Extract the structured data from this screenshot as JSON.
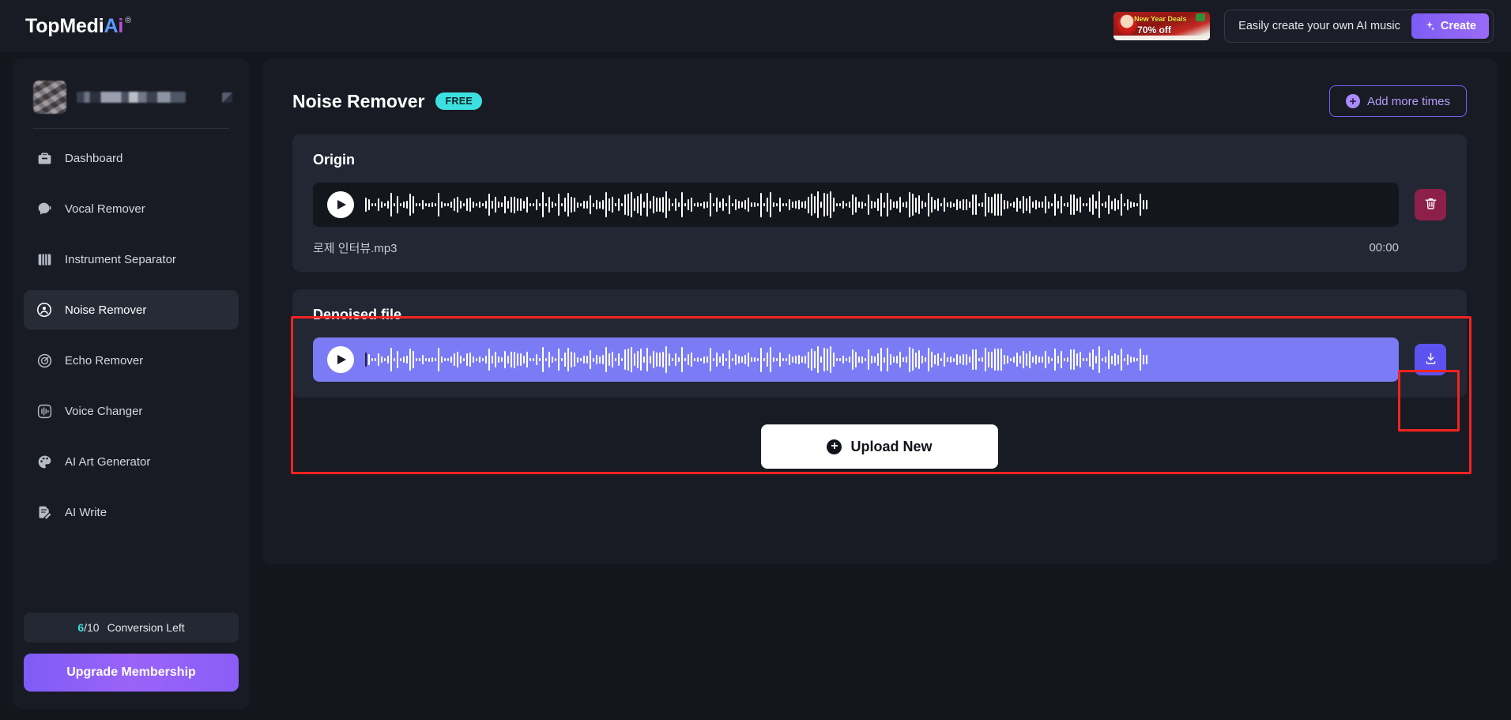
{
  "topbar": {
    "logo": {
      "prefix": "TopMedi",
      "mark_a": "A",
      "mark_i": "i",
      "registered": "®"
    },
    "promo": {
      "line1": "New Year Deals",
      "line2": "70% off"
    },
    "music_text": "Easily create your own AI music",
    "create_label": "Create",
    "spark_icon": "sparkle-icon"
  },
  "sidebar": {
    "profile": {
      "avatar_icon": "user-avatar",
      "name_redacted": "",
      "more_icon": "more-icon"
    },
    "items": [
      {
        "label": "Dashboard",
        "icon": "briefcase-icon",
        "active": false
      },
      {
        "label": "Vocal Remover",
        "icon": "vocal-icon",
        "active": false
      },
      {
        "label": "Instrument Separator",
        "icon": "piano-icon",
        "active": false
      },
      {
        "label": "Noise Remover",
        "icon": "noise-icon",
        "active": true
      },
      {
        "label": "Echo Remover",
        "icon": "echo-icon",
        "active": false
      },
      {
        "label": "Voice Changer",
        "icon": "voice-changer-icon",
        "active": false
      },
      {
        "label": "AI Art Generator",
        "icon": "palette-icon",
        "active": false
      },
      {
        "label": "AI Write",
        "icon": "write-icon",
        "active": false
      }
    ],
    "conversion": {
      "used": "6",
      "total": "/10",
      "label": "Conversion Left"
    },
    "upgrade_label": "Upgrade Membership"
  },
  "main": {
    "page_title": "Noise Remover",
    "free_badge": "FREE",
    "add_more_label": "Add more times",
    "origin": {
      "title": "Origin",
      "file_name": "로제 인터뷰.mp3",
      "time": "00:00",
      "play_icon": "play-icon",
      "delete_icon": "trash-icon"
    },
    "denoised": {
      "title": "Denoised file",
      "play_icon": "play-icon",
      "download_icon": "download-icon"
    },
    "upload_label": "Upload New"
  },
  "colors": {
    "accent_purple": "#7e5cf6",
    "denoised_player": "#7b7cf5",
    "free_badge": "#3de0e0",
    "annotation_red": "#f5231f",
    "delete_red": "#8d2049",
    "conversion_cyan": "#35e0dd"
  }
}
